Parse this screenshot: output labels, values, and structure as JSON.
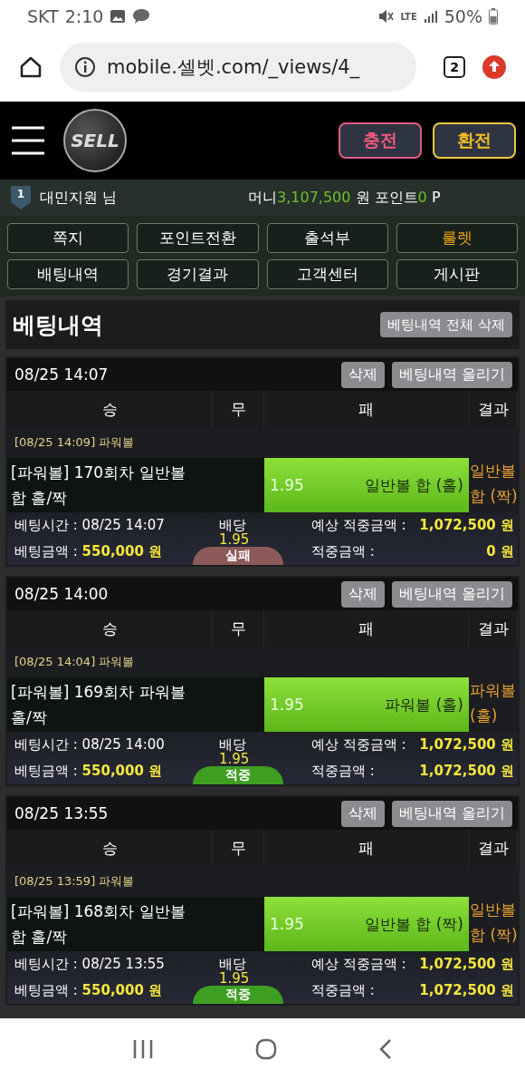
{
  "status_bar": {
    "carrier": "SKT",
    "time": "2:10",
    "network": "LTE",
    "battery": "50%"
  },
  "browser": {
    "url": "mobile.셀벳.com/_views/4_",
    "tab_count": "2"
  },
  "header": {
    "logo": "SELL",
    "buttons": [
      {
        "label": "충전",
        "kind": "charge"
      },
      {
        "label": "환전",
        "kind": "exchange"
      }
    ]
  },
  "user_bar": {
    "rank": "1",
    "name": "대민지원 님",
    "money_label": "머니",
    "money": "3,107,500",
    "money_unit": "원",
    "points_label": "포인트",
    "points": "0",
    "points_unit": "P"
  },
  "menu": [
    {
      "label": "쪽지",
      "highlighted": false
    },
    {
      "label": "포인트전환",
      "highlighted": false
    },
    {
      "label": "출석부",
      "highlighted": false
    },
    {
      "label": "룰렛",
      "highlighted": true
    },
    {
      "label": "배팅내역",
      "highlighted": false
    },
    {
      "label": "경기결과",
      "highlighted": false
    },
    {
      "label": "고객센터",
      "highlighted": false
    },
    {
      "label": "게시판",
      "highlighted": false
    }
  ],
  "page": {
    "title": "베팅내역",
    "delete_all": "베팅내역 전체 삭제"
  },
  "bets": [
    {
      "date": "08/25 14:07",
      "delete": "삭제",
      "upload": "베팅내역 올리기",
      "columns": [
        "승",
        "무",
        "패",
        "결과"
      ],
      "game_line": "[08/25 14:09] 파워볼",
      "title": "[파워볼] 170회차 일반볼 합 홀/짝",
      "odds": "1.95",
      "pick": "일반볼 합 (홀)",
      "result": "일반볼 합 (짝)",
      "bet_time_label": "베팅시간 :",
      "bet_time": "08/25 14:07",
      "stake_label": "베팅금액 :",
      "stake": "550,000 원",
      "payout_label": "배당",
      "payout": "1.95",
      "expected_label": "예상 적중금액 :",
      "expected": "1,072,500 원",
      "won_label": "적중금액 :",
      "won": "0 원",
      "status": {
        "label": "실패",
        "kind": "lose"
      }
    },
    {
      "date": "08/25 14:00",
      "delete": "삭제",
      "upload": "베팅내역 올리기",
      "columns": [
        "승",
        "무",
        "패",
        "결과"
      ],
      "game_line": "[08/25 14:04] 파워볼",
      "title": "[파워볼] 169회차 파워볼 홀/짝",
      "odds": "1.95",
      "pick": "파워볼 (홀)",
      "result": "파워볼 (홀)",
      "bet_time_label": "베팅시간 :",
      "bet_time": "08/25 14:00",
      "stake_label": "베팅금액 :",
      "stake": "550,000 원",
      "payout_label": "배당",
      "payout": "1.95",
      "expected_label": "예상 적중금액 :",
      "expected": "1,072,500 원",
      "won_label": "적중금액 :",
      "won": "1,072,500 원",
      "status": {
        "label": "적중",
        "kind": "win"
      }
    },
    {
      "date": "08/25 13:55",
      "delete": "삭제",
      "upload": "베팅내역 올리기",
      "columns": [
        "승",
        "무",
        "패",
        "결과"
      ],
      "game_line": "[08/25 13:59] 파워볼",
      "title": "[파워볼] 168회차 일반볼 합 홀/짝",
      "odds": "1.95",
      "pick": "일반볼 합 (짝)",
      "result": "일반볼 합 (짝)",
      "bet_time_label": "베팅시간 :",
      "bet_time": "08/25 13:55",
      "stake_label": "베팅금액 :",
      "stake": "550,000 원",
      "payout_label": "배당",
      "payout": "1.95",
      "expected_label": "예상 적중금액 :",
      "expected": "1,072,500 원",
      "won_label": "적중금액 :",
      "won": "1,072,500 원",
      "status": {
        "label": "적중",
        "kind": "win"
      }
    }
  ]
}
